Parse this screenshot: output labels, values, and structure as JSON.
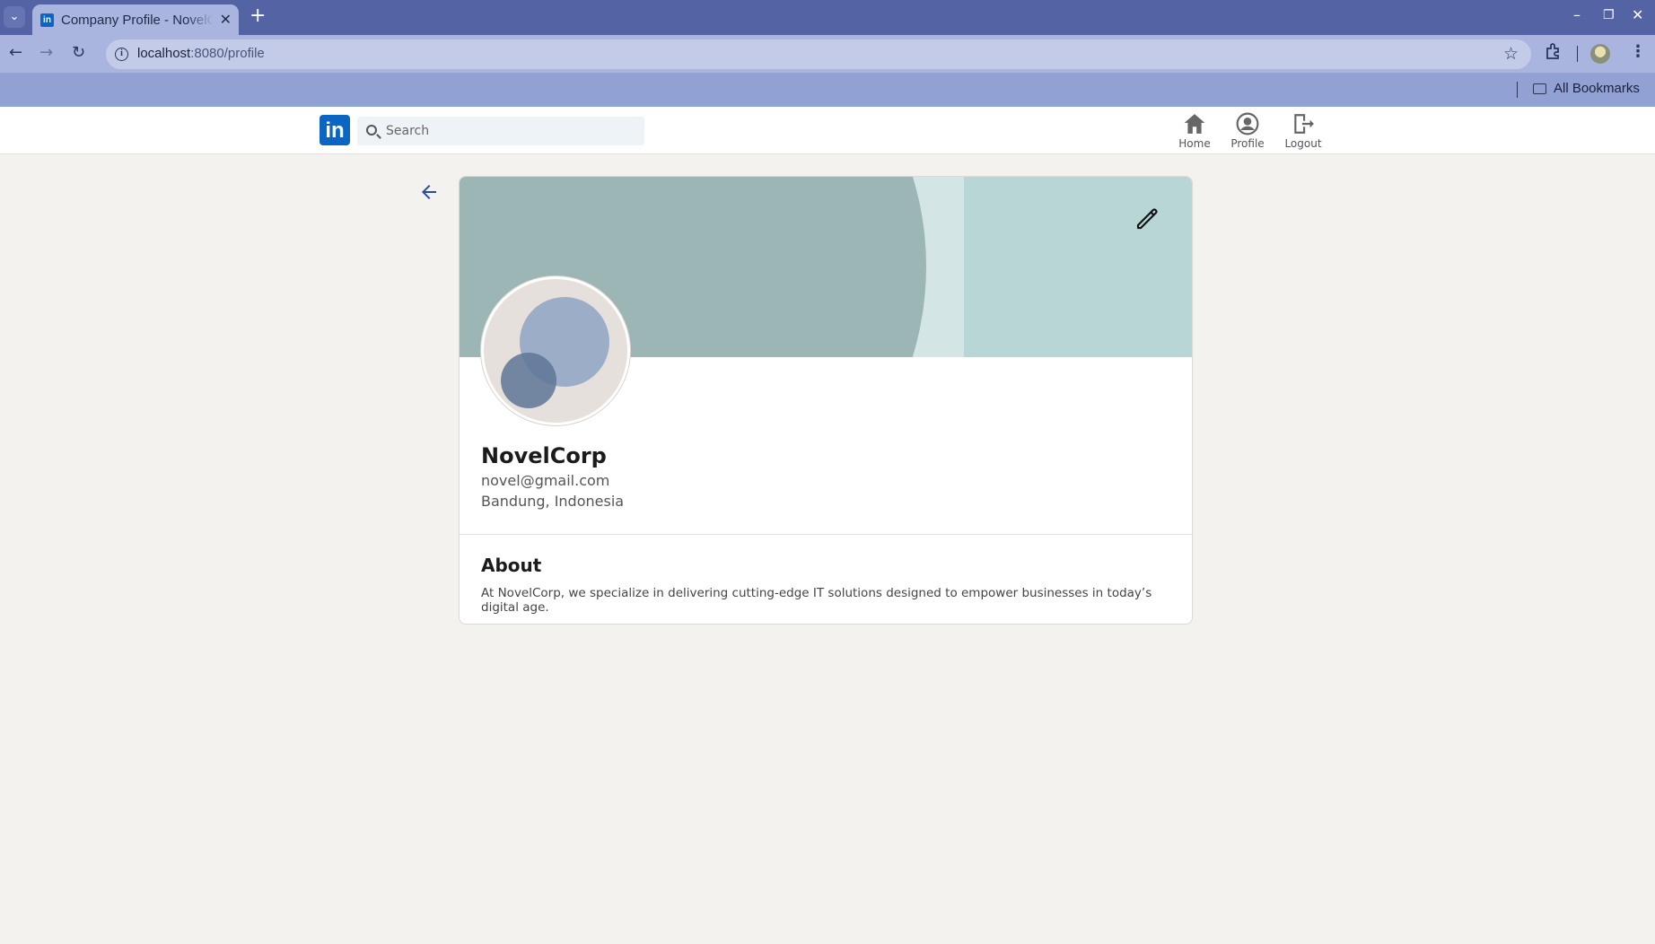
{
  "browser": {
    "tab_title": "Company Profile - NovelCorp",
    "url_host": "localhost",
    "url_path": ":8080/profile",
    "bookmarks_label": "All Bookmarks",
    "icons": [
      "tab-list-icon",
      "close-icon",
      "plus-icon",
      "back-icon",
      "forward-icon",
      "reload-icon",
      "info-icon",
      "star-icon",
      "extensions-icon",
      "menu-icon",
      "folder-icon"
    ]
  },
  "header": {
    "logo": "in",
    "search_placeholder": "Search",
    "nav": [
      {
        "label": "Home",
        "icon": "home-icon"
      },
      {
        "label": "Profile",
        "icon": "user-icon"
      },
      {
        "label": "Logout",
        "icon": "logout-icon"
      }
    ]
  },
  "profile": {
    "name": "NovelCorp",
    "email": "novel@gmail.com",
    "location": "Bandung, Indonesia",
    "about_title": "About",
    "about_text": "At NovelCorp, we specialize in delivering cutting-edge IT solutions designed to empower businesses in today’s digital age."
  },
  "colors": {
    "brand": "#0a66c2",
    "browser_frame": "#5363a4",
    "page_bg": "#f3f2ef",
    "banner": "#b9d6d6"
  }
}
